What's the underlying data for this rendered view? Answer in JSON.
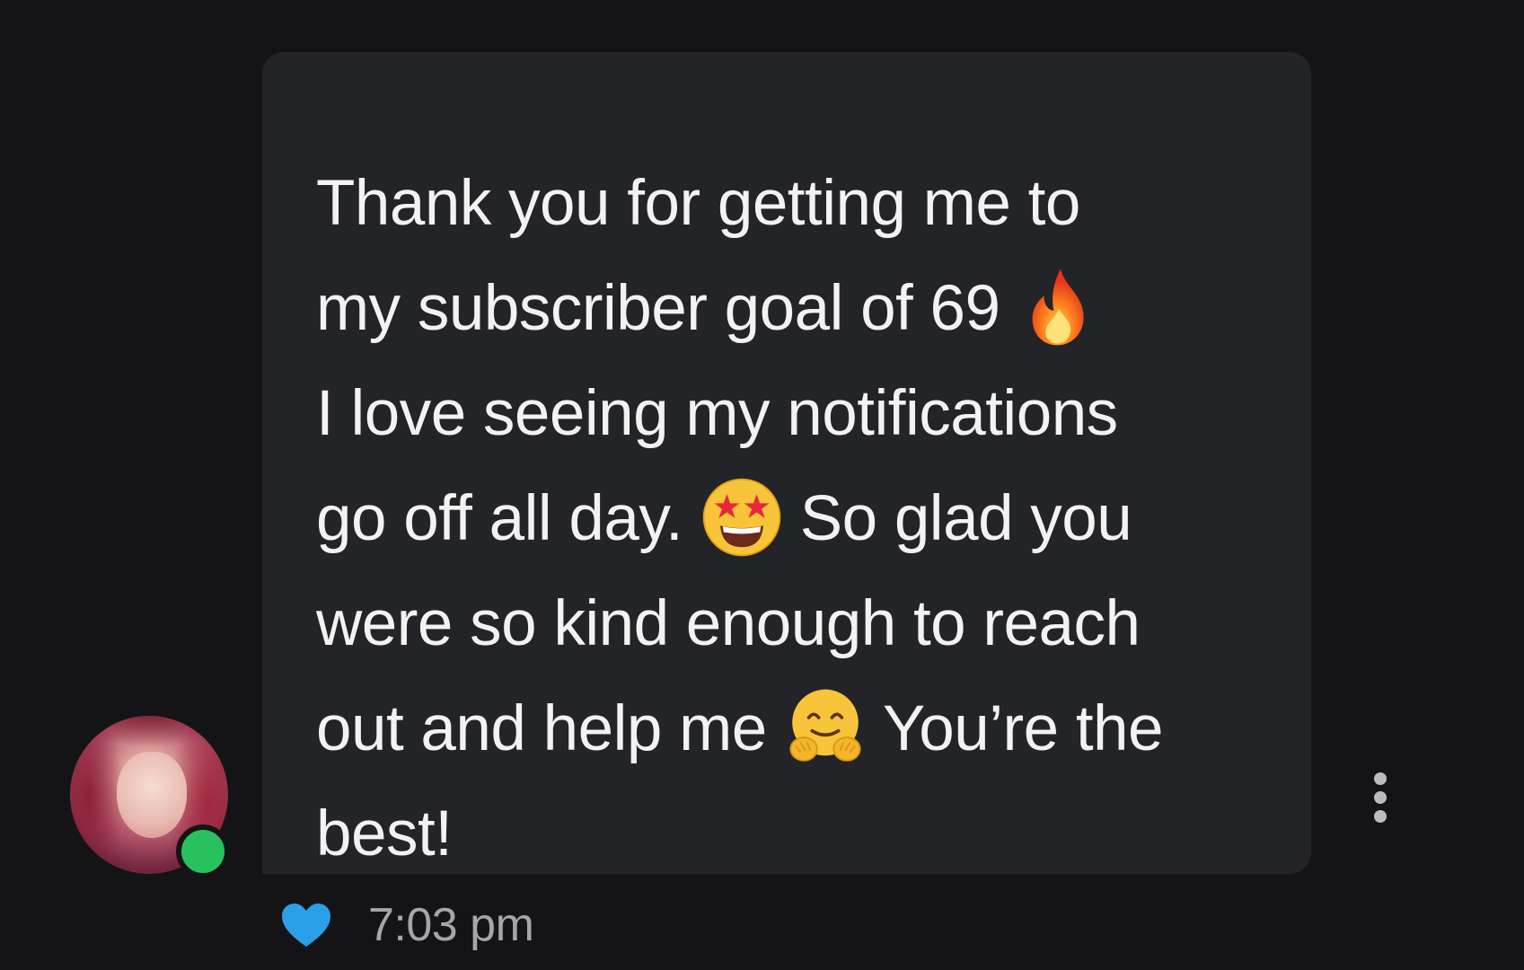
{
  "message": {
    "line_1": "Thank you for getting me to",
    "line_2a": "my subscriber goal of 69",
    "line_3": "I love seeing my notifications",
    "line_4a": "go off all day.",
    "line_4b": "So glad you",
    "line_5": "were so kind enough to reach",
    "line_6a": "out and help me",
    "line_6b": "You’re the",
    "line_7": "best!",
    "emojis": [
      "fire-emoji",
      "star-struck-emoji",
      "hugging-face-emoji"
    ]
  },
  "meta": {
    "timestamp": "7:03 pm",
    "reaction_icon": "heart-icon",
    "heart_color": "#2b9fe8",
    "online_color": "#27c25e"
  },
  "avatar": {
    "status": "online"
  }
}
